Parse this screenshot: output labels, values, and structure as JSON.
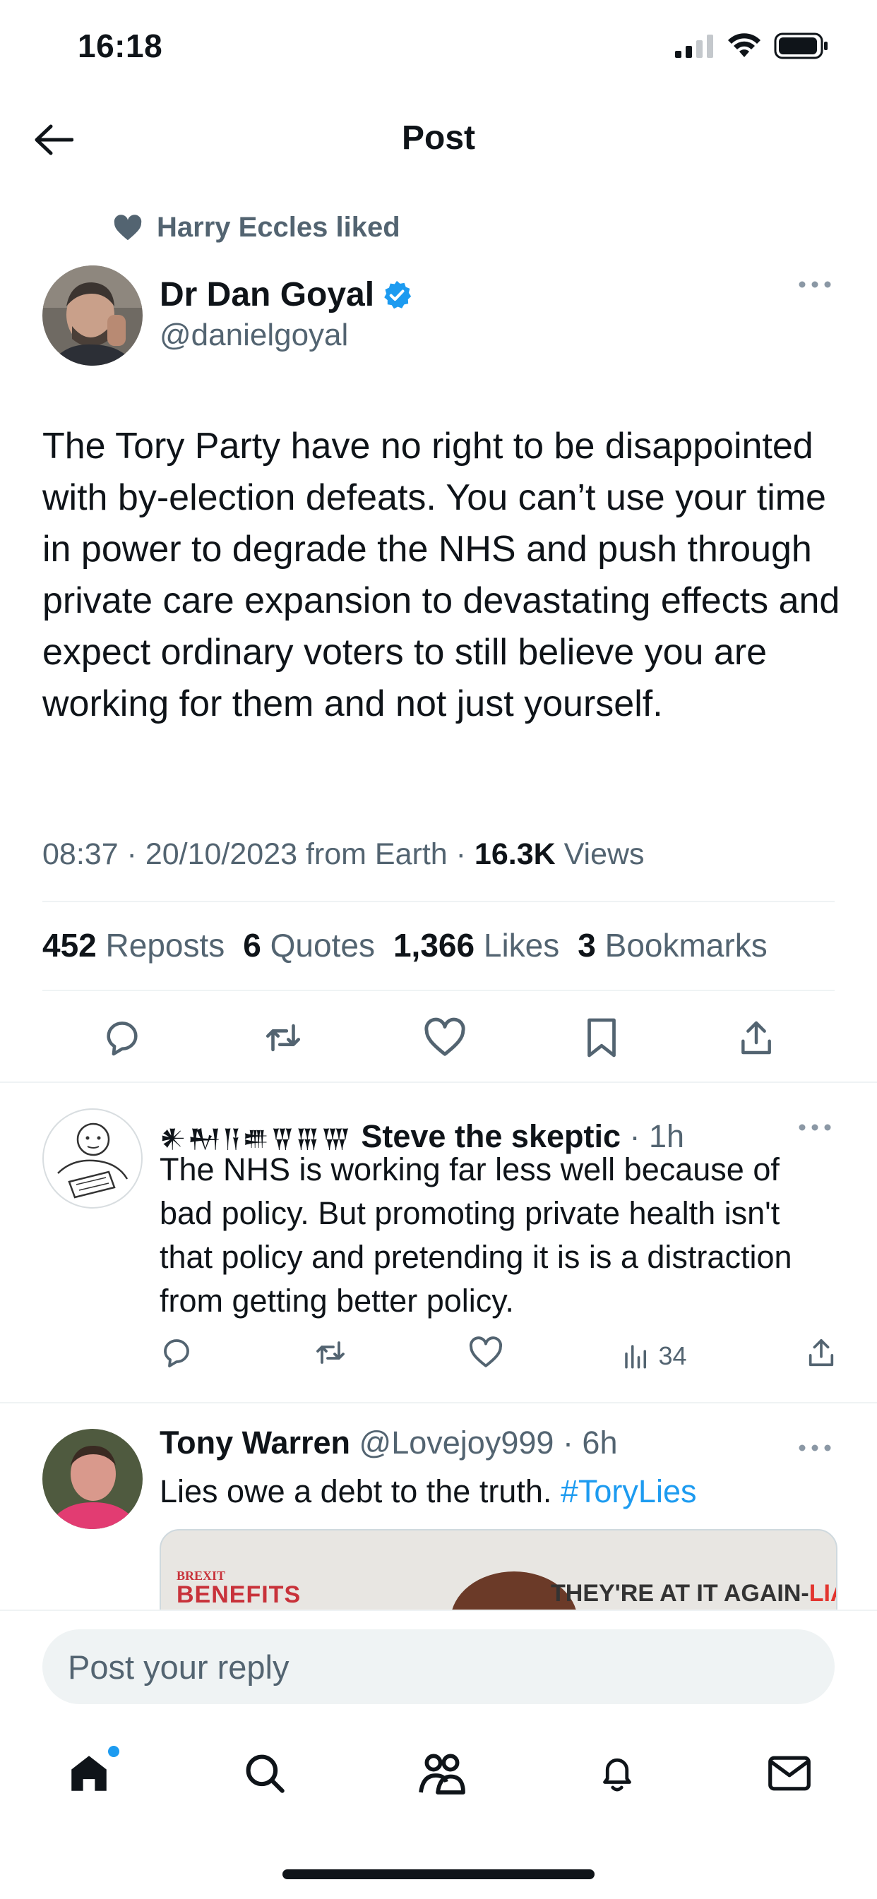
{
  "status_bar": {
    "time": "16:18"
  },
  "header": {
    "title": "Post"
  },
  "liked_by": {
    "text": "Harry Eccles liked"
  },
  "tweet": {
    "author_name": "Dr Dan Goyal",
    "author_handle": "@danielgoyal",
    "text": "The Tory Party have no right to be disappointed with by-election defeats. You can’t use your time in power to degrade the NHS and push through private care expansion to devastating effects and expect ordinary voters to still believe you are working for them and not just yourself.",
    "meta_prefix": "08:37 · 20/10/2023 from Earth · ",
    "views_count": "16.3K",
    "views_label": " Views",
    "stats": {
      "reposts_count": "452",
      "reposts_label": "Reposts",
      "quotes_count": "6",
      "quotes_label": "Quotes",
      "likes_count": "1,366",
      "likes_label": "Likes",
      "bookmarks_count": "3",
      "bookmarks_label": "Bookmarks"
    }
  },
  "replies": [
    {
      "glyphs": "𒀭𒈹𒀀𒌑𒐊𒐋𒐌",
      "name": "Steve the skeptic",
      "time": "· 1h",
      "text": "The NHS is working far less well because of bad policy. But promoting private health isn't that policy and pretending it is is a distraction from getting better policy.",
      "views": "34"
    },
    {
      "name": "Tony Warren",
      "handle": "@Lovejoy999",
      "time": "· 6h",
      "text": "Lies owe a debt to the truth. ",
      "hashtag": "#ToryLies",
      "image_text_left_top": "BREXIT",
      "image_text_left": "BENEFITS",
      "image_text_right": "THEY'RE AT IT AGAIN-",
      "image_text_right_accent": "LIARS!"
    }
  ],
  "reply_input": {
    "placeholder": "Post your reply"
  },
  "colors": {
    "accent": "#1d9bf0",
    "muted": "#536471",
    "text": "#0f1419",
    "divider": "#eff3f4"
  }
}
